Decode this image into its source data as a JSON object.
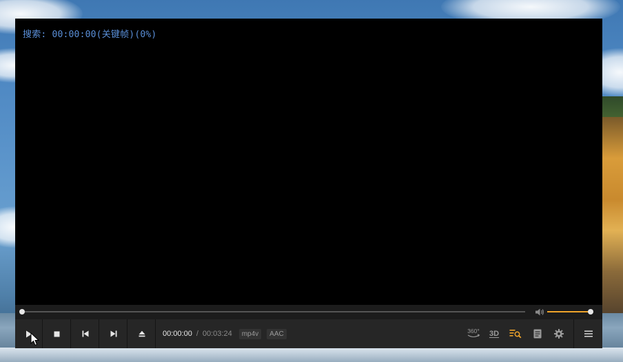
{
  "osd": {
    "text": "搜索: 00:00:00(关键帧)(0%)"
  },
  "playback": {
    "current_time": "00:00:00",
    "separator": "/",
    "total_time": "00:03:24",
    "seek_progress": 0.0,
    "volume_level": 1.0
  },
  "badges": {
    "video_codec": "mp4v",
    "audio_codec": "AAC"
  },
  "buttons": {
    "vr360_label": "360°",
    "three_d_label": "3D"
  },
  "icons": {
    "play": "play-icon",
    "stop": "stop-icon",
    "prev": "previous-icon",
    "next": "next-icon",
    "eject": "eject-icon",
    "volume": "speaker-icon",
    "playlist_search": "playlist-search-icon",
    "subtitle": "subtitle-icon",
    "settings": "gear-icon",
    "menu": "hamburger-menu-icon"
  },
  "colors": {
    "accent": "#f0a42a",
    "osd_text": "#5a8fd8",
    "control_bg": "#262626"
  }
}
